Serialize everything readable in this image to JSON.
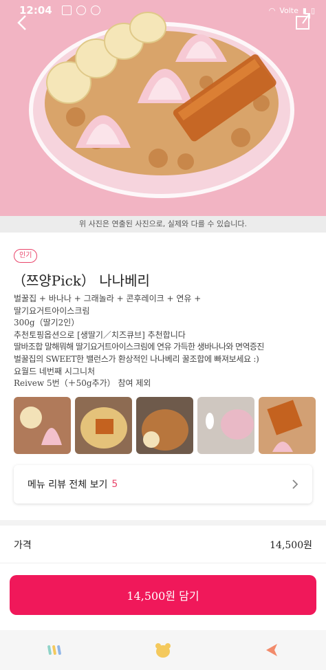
{
  "status_bar": {
    "time": "12:04",
    "network": "Volte"
  },
  "photo_notice": "위 사진은 연출된 사진으로, 실제와 다를 수 있습니다.",
  "badge": "인기",
  "product": {
    "title": "（쯔양Pick） 나나베리",
    "description_lines": [
      "벌꿀집 + 바나나 + 그래놀라 + 콘후레이크 + 연유 +",
      "딸기요거트아이스크림",
      "300g（딸기2인）",
      "추천토핑옵션으로 [생딸기／치즈큐브] 추천합니다",
      "딸바조합 말해뭐해 딸기요거트아이스크림에 연유 가득한 생바나나와 면역증진",
      "벌꿀집의 SWEET한 밸런스가 환상적인 나나베리 꿀조합에 빠져보세요 :)",
      "요월드 네번째 시그니처",
      "Reivew 5번（＋50g추가） 참여 제외"
    ]
  },
  "reviews": {
    "label": "메뉴 리뷰 전체 보기",
    "count": "5"
  },
  "price": {
    "label": "가격",
    "value": "14,500원"
  },
  "cta": {
    "label": "14,500원 담기"
  },
  "colors": {
    "accent": "#f0185a",
    "badge": "#e9446a",
    "hero_bg": "#f2b4c3"
  },
  "icons": [
    "back-arrow-icon",
    "share-icon",
    "chevron-right-icon",
    "menu-bars-icon",
    "bear-icon",
    "arrow-left-icon"
  ]
}
